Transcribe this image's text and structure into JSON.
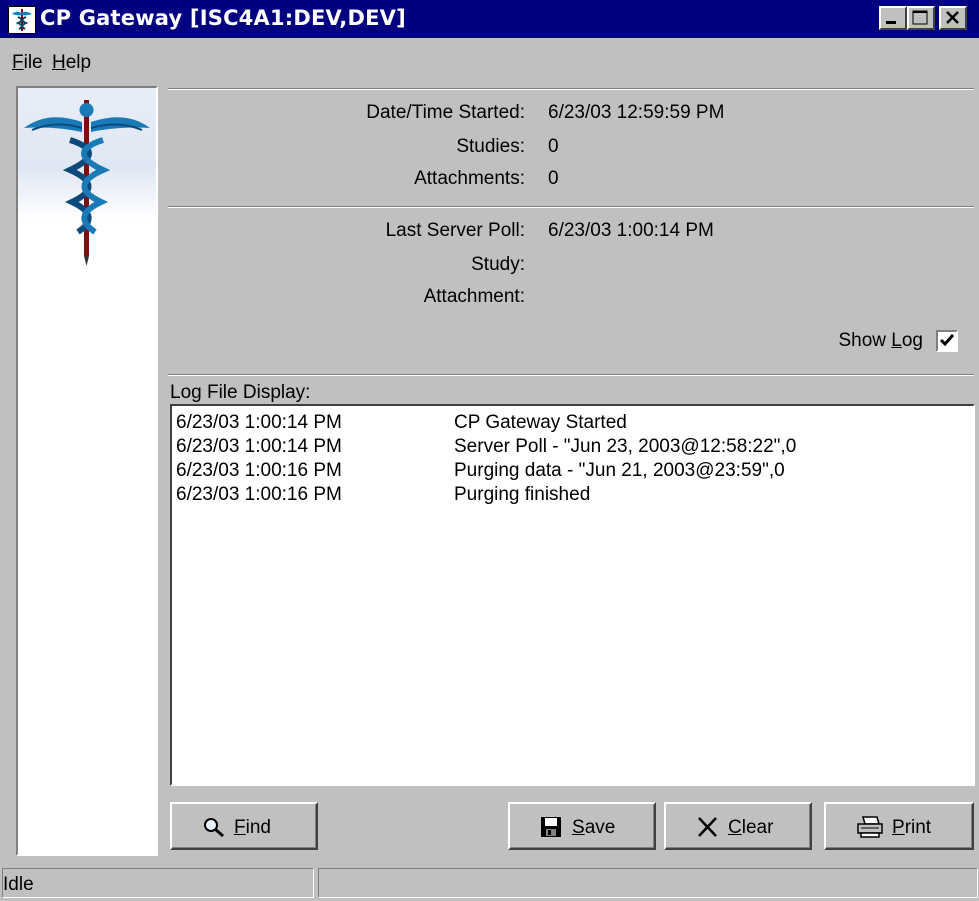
{
  "window": {
    "title": "CP Gateway [ISC4A1:DEV,DEV]",
    "title_bar_color": "#000080",
    "app_icon": "caduceus-icon"
  },
  "menu": {
    "file": {
      "accel": "F",
      "rest": "ile"
    },
    "help": {
      "accel": "H",
      "rest": "elp"
    }
  },
  "stats": {
    "date_started_label": "Date/Time Started:",
    "date_started_value": "6/23/03 12:59:59 PM",
    "studies_label": "Studies:",
    "studies_value": "0",
    "attachments_label": "Attachments:",
    "attachments_value": "0"
  },
  "poll": {
    "last_poll_label": "Last Server Poll:",
    "last_poll_value": "6/23/03 1:00:14 PM",
    "study_label": "Study:",
    "study_value": "",
    "attachment_label": "Attachment:",
    "attachment_value": ""
  },
  "show_log": {
    "prefix": "Show ",
    "accel": "L",
    "rest": "og",
    "checked": true
  },
  "log": {
    "label": "Log File Display:",
    "entries": [
      {
        "time": "6/23/03 1:00:14 PM",
        "message": "CP Gateway Started"
      },
      {
        "time": "6/23/03 1:00:14 PM",
        "message": "Server Poll - \"Jun 23, 2003@12:58:22\",0"
      },
      {
        "time": "6/23/03 1:00:16 PM",
        "message": "Purging data - \"Jun 21, 2003@23:59\",0"
      },
      {
        "time": "6/23/03 1:00:16 PM",
        "message": "Purging finished"
      }
    ]
  },
  "buttons": {
    "find": {
      "accel": "F",
      "rest": "ind",
      "icon": "magnifier-icon"
    },
    "save": {
      "accel": "S",
      "rest": "ave",
      "icon": "floppy-disk-icon"
    },
    "clear": {
      "accel": "C",
      "rest": "lear",
      "icon": "x-icon"
    },
    "print": {
      "accel": "P",
      "rest": "rint",
      "icon": "printer-icon"
    }
  },
  "status": {
    "panel1": "Idle",
    "panel2": ""
  }
}
